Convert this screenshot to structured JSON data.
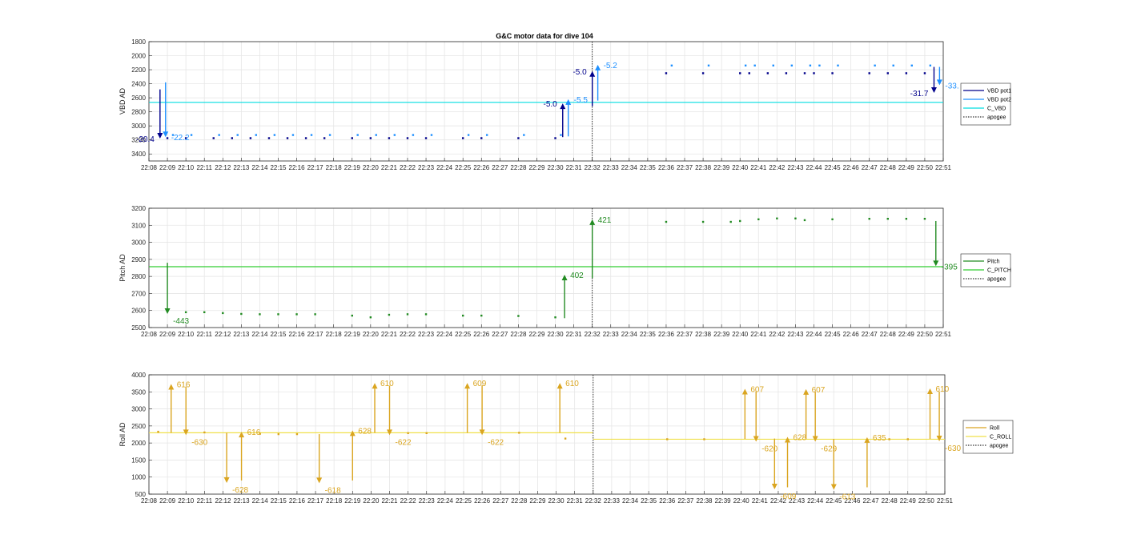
{
  "title": "G&C motor data for dive 104",
  "chart_data": [
    {
      "type": "line",
      "ylabel": "VBD AD",
      "ylim": [
        1800,
        3500
      ],
      "y_reversed": true,
      "yticks": [
        1800,
        2000,
        2200,
        2400,
        2600,
        2800,
        3000,
        3200,
        3400
      ],
      "xlim": [
        "22:08",
        "22:51"
      ],
      "xticks": [
        "22:08",
        "22:09",
        "22:10",
        "22:11",
        "22:12",
        "22:13",
        "22:14",
        "22:15",
        "22:16",
        "22:17",
        "22:18",
        "22:19",
        "22:20",
        "22:21",
        "22:22",
        "22:23",
        "22:24",
        "22:25",
        "22:26",
        "22:27",
        "22:28",
        "22:29",
        "22:30",
        "22:31",
        "22:32",
        "22:33",
        "22:34",
        "22:35",
        "22:36",
        "22:37",
        "22:38",
        "22:39",
        "22:40",
        "22:41",
        "22:42",
        "22:43",
        "22:44",
        "22:45",
        "22:46",
        "22:47",
        "22:48",
        "22:49",
        "22:50",
        "22:51"
      ],
      "grid": true,
      "legend": {
        "position": "right",
        "entries": [
          {
            "label": "VBD pot1",
            "color": "#00008b",
            "style": "solid"
          },
          {
            "label": "VBD pot2",
            "color": "#1e90ff",
            "style": "solid"
          },
          {
            "label": "C_VBD",
            "color": "#00dde0",
            "style": "solid"
          },
          {
            "label": "apogee",
            "color": "#000000",
            "style": "dotted"
          }
        ]
      },
      "hlines": [
        {
          "y": 2665,
          "x_start": "22:08",
          "x_end": "22:51",
          "color": "#00dde0"
        }
      ],
      "vlines": [
        {
          "x": "22:32",
          "color": "#000000",
          "style": "dotted"
        }
      ],
      "arrows": [
        {
          "x": "22:08.6",
          "y0": 2480,
          "y1": 3180,
          "color": "#00008b",
          "label": "-20.4",
          "label_side": "left"
        },
        {
          "x": "22:08.9",
          "y0": 2380,
          "y1": 3160,
          "color": "#1e90ff",
          "label": "-22.2",
          "label_side": "right"
        },
        {
          "x": "22:30.4",
          "y0": 3160,
          "y1": 2680,
          "color": "#00008b",
          "label": "-5.0",
          "label_side": "left"
        },
        {
          "x": "22:30.7",
          "y0": 3150,
          "y1": 2620,
          "color": "#1e90ff",
          "label": "-5.5",
          "label_side": "right"
        },
        {
          "x": "22:32.0",
          "y0": 2720,
          "y1": 2220,
          "color": "#00008b",
          "label": "-5.0",
          "label_side": "left"
        },
        {
          "x": "22:32.3",
          "y0": 2640,
          "y1": 2130,
          "color": "#1e90ff",
          "label": "-5.2",
          "label_side": "right"
        },
        {
          "x": "22:50.5",
          "y0": 2160,
          "y1": 2530,
          "color": "#00008b",
          "label": "-31.7",
          "label_side": "left"
        },
        {
          "x": "22:50.8",
          "y0": 2160,
          "y1": 2420,
          "color": "#1e90ff",
          "label": "-33.",
          "label_side": "right"
        }
      ],
      "series": [
        {
          "color": "#00008b",
          "x": [
            "22:09.0",
            "22:10.0",
            "22:11.5",
            "22:12.5",
            "22:13.5",
            "22:14.5",
            "22:15.5",
            "22:16.5",
            "22:17.5",
            "22:19.0",
            "22:20.0",
            "22:21.0",
            "22:22.0",
            "22:23.0",
            "22:25.0",
            "22:26.0",
            "22:28.0",
            "22:30.0",
            "22:36.0",
            "22:38.0",
            "22:40.0",
            "22:40.5",
            "22:41.5",
            "22:42.5",
            "22:43.5",
            "22:44.0",
            "22:45.0",
            "22:47.0",
            "22:48.0",
            "22:49.0",
            "22:50.0"
          ],
          "y": [
            3175,
            3175,
            3175,
            3175,
            3175,
            3175,
            3175,
            3175,
            3175,
            3175,
            3175,
            3175,
            3175,
            3175,
            3175,
            3175,
            3175,
            3175,
            2250,
            2250,
            2250,
            2250,
            2250,
            2250,
            2250,
            2250,
            2250,
            2250,
            2250,
            2250,
            2250
          ]
        },
        {
          "color": "#1e90ff",
          "x": [
            "22:09.3",
            "22:10.3",
            "22:11.8",
            "22:12.8",
            "22:13.8",
            "22:14.8",
            "22:15.8",
            "22:16.8",
            "22:17.8",
            "22:19.3",
            "22:20.3",
            "22:21.3",
            "22:22.3",
            "22:23.3",
            "22:25.3",
            "22:26.3",
            "22:28.3",
            "22:30.3",
            "22:36.3",
            "22:38.3",
            "22:40.3",
            "22:40.8",
            "22:41.8",
            "22:42.8",
            "22:43.8",
            "22:44.3",
            "22:45.3",
            "22:47.3",
            "22:48.3",
            "22:49.3",
            "22:50.3"
          ],
          "y": [
            3130,
            3130,
            3130,
            3130,
            3130,
            3130,
            3130,
            3130,
            3130,
            3130,
            3130,
            3130,
            3130,
            3130,
            3130,
            3130,
            3130,
            3130,
            2140,
            2140,
            2140,
            2140,
            2140,
            2140,
            2140,
            2140,
            2140,
            2140,
            2140,
            2140,
            2140
          ]
        }
      ]
    },
    {
      "type": "line",
      "ylabel": "Pitch AD",
      "ylim": [
        2500,
        3200
      ],
      "y_reversed": false,
      "yticks": [
        2500,
        2600,
        2700,
        2800,
        2900,
        3000,
        3100,
        3200
      ],
      "xlim": [
        "22:08",
        "22:51"
      ],
      "xticks": [
        "22:08",
        "22:09",
        "22:10",
        "22:11",
        "22:12",
        "22:13",
        "22:14",
        "22:15",
        "22:16",
        "22:17",
        "22:18",
        "22:19",
        "22:20",
        "22:21",
        "22:22",
        "22:23",
        "22:24",
        "22:25",
        "22:26",
        "22:27",
        "22:28",
        "22:29",
        "22:30",
        "22:31",
        "22:32",
        "22:33",
        "22:34",
        "22:35",
        "22:36",
        "22:37",
        "22:38",
        "22:39",
        "22:40",
        "22:41",
        "22:42",
        "22:43",
        "22:44",
        "22:45",
        "22:46",
        "22:47",
        "22:48",
        "22:49",
        "22:50",
        "22:51"
      ],
      "grid": true,
      "legend": {
        "position": "right",
        "entries": [
          {
            "label": "Pitch",
            "color": "#228b22",
            "style": "solid"
          },
          {
            "label": "C_PITCH",
            "color": "#32cd32",
            "style": "solid"
          },
          {
            "label": "apogee",
            "color": "#000000",
            "style": "dotted"
          }
        ]
      },
      "hlines": [
        {
          "y": 2857,
          "x_start": "22:08",
          "x_end": "22:51",
          "color": "#32cd32"
        }
      ],
      "vlines": [
        {
          "x": "22:32",
          "color": "#000000",
          "style": "dotted"
        }
      ],
      "arrows": [
        {
          "x": "22:09.0",
          "y0": 2880,
          "y1": 2580,
          "color": "#228b22",
          "label": "-443",
          "label_side": "right-below"
        },
        {
          "x": "22:30.5",
          "y0": 2555,
          "y1": 2810,
          "color": "#228b22",
          "label": "402",
          "label_side": "right"
        },
        {
          "x": "22:32.0",
          "y0": 2790,
          "y1": 3135,
          "color": "#228b22",
          "label": "421",
          "label_side": "right"
        },
        {
          "x": "22:50.6",
          "y0": 3125,
          "y1": 2860,
          "color": "#228b22",
          "label": "-395",
          "label_side": "right"
        }
      ],
      "series": [
        {
          "color": "#228b22",
          "x": [
            "22:10.0",
            "22:11.0",
            "22:12.0",
            "22:13.0",
            "22:14.0",
            "22:15.0",
            "22:16.0",
            "22:17.0",
            "22:19.0",
            "22:20.0",
            "22:21.0",
            "22:22.0",
            "22:23.0",
            "22:25.0",
            "22:26.0",
            "22:28.0",
            "22:30.0",
            "22:36.0",
            "22:38.0",
            "22:39.5",
            "22:40.0",
            "22:41.0",
            "22:42.0",
            "22:43.0",
            "22:43.5",
            "22:45.0",
            "22:47.0",
            "22:48.0",
            "22:49.0",
            "22:50.0"
          ],
          "y": [
            2590,
            2590,
            2585,
            2580,
            2578,
            2578,
            2578,
            2578,
            2570,
            2560,
            2575,
            2578,
            2578,
            2570,
            2570,
            2568,
            2560,
            3120,
            3120,
            3120,
            3125,
            3135,
            3140,
            3140,
            3130,
            3135,
            3138,
            3138,
            3138,
            3138
          ]
        }
      ]
    },
    {
      "type": "line",
      "ylabel": "Roll AD",
      "ylim": [
        500,
        4000
      ],
      "y_reversed": false,
      "yticks": [
        500,
        1000,
        1500,
        2000,
        2500,
        3000,
        3500,
        4000
      ],
      "xlim": [
        "22:08",
        "22:51"
      ],
      "xticks": [
        "22:08",
        "22:09",
        "22:10",
        "22:11",
        "22:12",
        "22:13",
        "22:14",
        "22:15",
        "22:16",
        "22:17",
        "22:18",
        "22:19",
        "22:20",
        "22:21",
        "22:22",
        "22:23",
        "22:24",
        "22:25",
        "22:26",
        "22:27",
        "22:28",
        "22:29",
        "22:30",
        "22:31",
        "22:32",
        "22:33",
        "22:34",
        "22:35",
        "22:36",
        "22:37",
        "22:38",
        "22:39",
        "22:40",
        "22:41",
        "22:42",
        "22:43",
        "22:44",
        "22:45",
        "22:46",
        "22:47",
        "22:48",
        "22:49",
        "22:50",
        "22:51"
      ],
      "grid": true,
      "legend": {
        "position": "right",
        "entries": [
          {
            "label": "Roll",
            "color": "#daa520",
            "style": "solid"
          },
          {
            "label": "C_ROLL",
            "color": "#f0e04a",
            "style": "solid"
          },
          {
            "label": "apogee",
            "color": "#000000",
            "style": "dotted"
          }
        ]
      },
      "hlines": [
        {
          "y": 2300,
          "x_start": "22:08",
          "x_end": "22:32",
          "color": "#f0e04a"
        },
        {
          "y": 2110,
          "x_start": "22:32",
          "x_end": "22:51",
          "color": "#f0e04a"
        }
      ],
      "vlines": [
        {
          "x": "22:32",
          "color": "#000000",
          "style": "dotted"
        }
      ],
      "arrows": [
        {
          "x": "22:09.2",
          "y0": 2300,
          "y1": 3730,
          "color": "#daa520",
          "label": "616",
          "label_side": "right"
        },
        {
          "x": "22:10.0",
          "y0": 3650,
          "y1": 2230,
          "color": "#daa520",
          "label": "-630",
          "label_side": "right-below"
        },
        {
          "x": "22:12.2",
          "y0": 2300,
          "y1": 830,
          "color": "#daa520",
          "label": "-628",
          "label_side": "right-below"
        },
        {
          "x": "22:13.0",
          "y0": 900,
          "y1": 2330,
          "color": "#daa520",
          "label": "616",
          "label_side": "right"
        },
        {
          "x": "22:17.2",
          "y0": 2260,
          "y1": 820,
          "color": "#daa520",
          "label": "-618",
          "label_side": "right-below"
        },
        {
          "x": "22:19.0",
          "y0": 900,
          "y1": 2370,
          "color": "#daa520",
          "label": "628",
          "label_side": "right"
        },
        {
          "x": "22:20.2",
          "y0": 2300,
          "y1": 3760,
          "color": "#daa520",
          "label": "610",
          "label_side": "right"
        },
        {
          "x": "22:21.0",
          "y0": 3680,
          "y1": 2230,
          "color": "#daa520",
          "label": "-622",
          "label_side": "right-below"
        },
        {
          "x": "22:25.2",
          "y0": 2300,
          "y1": 3760,
          "color": "#daa520",
          "label": "609",
          "label_side": "right"
        },
        {
          "x": "22:26.0",
          "y0": 3690,
          "y1": 2230,
          "color": "#daa520",
          "label": "-622",
          "label_side": "right-below"
        },
        {
          "x": "22:30.2",
          "y0": 2300,
          "y1": 3760,
          "color": "#daa520",
          "label": "610",
          "label_side": "right"
        },
        {
          "x": "22:40.2",
          "y0": 2120,
          "y1": 3590,
          "color": "#daa520",
          "label": "607",
          "label_side": "right"
        },
        {
          "x": "22:40.8",
          "y0": 3510,
          "y1": 2040,
          "color": "#daa520",
          "label": "-620",
          "label_side": "right-below"
        },
        {
          "x": "22:41.8",
          "y0": 2130,
          "y1": 640,
          "color": "#daa520",
          "label": "-609",
          "label_side": "right-below"
        },
        {
          "x": "22:42.5",
          "y0": 700,
          "y1": 2180,
          "color": "#daa520",
          "label": "628",
          "label_side": "right"
        },
        {
          "x": "22:43.5",
          "y0": 2120,
          "y1": 3580,
          "color": "#daa520",
          "label": "607",
          "label_side": "right"
        },
        {
          "x": "22:44.0",
          "y0": 3500,
          "y1": 2040,
          "color": "#daa520",
          "label": "-629",
          "label_side": "right-below"
        },
        {
          "x": "22:45.0",
          "y0": 2120,
          "y1": 630,
          "color": "#daa520",
          "label": "-613",
          "label_side": "right-below"
        },
        {
          "x": "22:46.8",
          "y0": 700,
          "y1": 2170,
          "color": "#daa520",
          "label": "635",
          "label_side": "right"
        },
        {
          "x": "22:50.2",
          "y0": 2120,
          "y1": 3600,
          "color": "#daa520",
          "label": "610",
          "label_side": "right"
        },
        {
          "x": "22:50.7",
          "y0": 3510,
          "y1": 2050,
          "color": "#daa520",
          "label": "-630",
          "label_side": "right-below"
        }
      ],
      "series": [
        {
          "color": "#daa520",
          "x": [
            "22:08.5",
            "22:11.0",
            "22:14.0",
            "22:15.0",
            "22:16.0",
            "22:22.0",
            "22:23.0",
            "22:28.0",
            "22:30.5",
            "22:36.0",
            "22:38.0",
            "22:48.0",
            "22:49.0"
          ],
          "y": [
            2330,
            2310,
            2270,
            2260,
            2260,
            2290,
            2290,
            2300,
            2130,
            2110,
            2110,
            2110,
            2110
          ]
        }
      ]
    }
  ]
}
